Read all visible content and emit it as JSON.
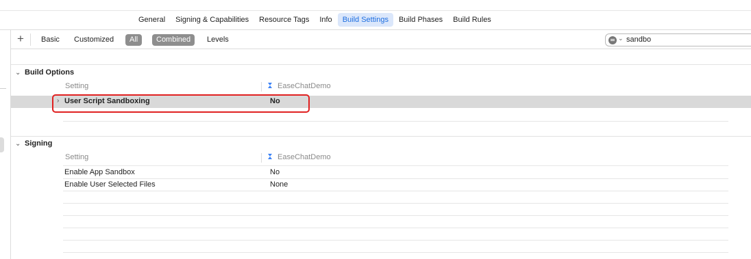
{
  "tabs": [
    {
      "label": "General"
    },
    {
      "label": "Signing & Capabilities"
    },
    {
      "label": "Resource Tags"
    },
    {
      "label": "Info"
    },
    {
      "label": "Build Settings",
      "active": true
    },
    {
      "label": "Build Phases"
    },
    {
      "label": "Build Rules"
    }
  ],
  "filterbar": {
    "add_label": "+",
    "basic": "Basic",
    "customized": "Customized",
    "all": "All",
    "combined": "Combined",
    "levels": "Levels",
    "search_value": "sandbo"
  },
  "build_options": {
    "title": "Build Options",
    "col_setting": "Setting",
    "col_target": "EaseChatDemo",
    "rows": [
      {
        "name": "User Script Sandboxing",
        "value": "No",
        "selected": true
      }
    ]
  },
  "signing": {
    "title": "Signing",
    "col_setting": "Setting",
    "col_target": "EaseChatDemo",
    "rows": [
      {
        "name": "Enable App Sandbox",
        "value": "No"
      },
      {
        "name": "Enable User Selected Files",
        "value": "None"
      }
    ]
  },
  "colors": {
    "accent": "#1f6fe0",
    "tab_active_bg": "#dbe7fb",
    "highlight_box": "#e02020",
    "selected_row": "#d9d9d9"
  },
  "icons": {
    "target": "xcode-target-icon",
    "search": "search-filter-icon",
    "disclosure": "chevron-down-icon"
  }
}
